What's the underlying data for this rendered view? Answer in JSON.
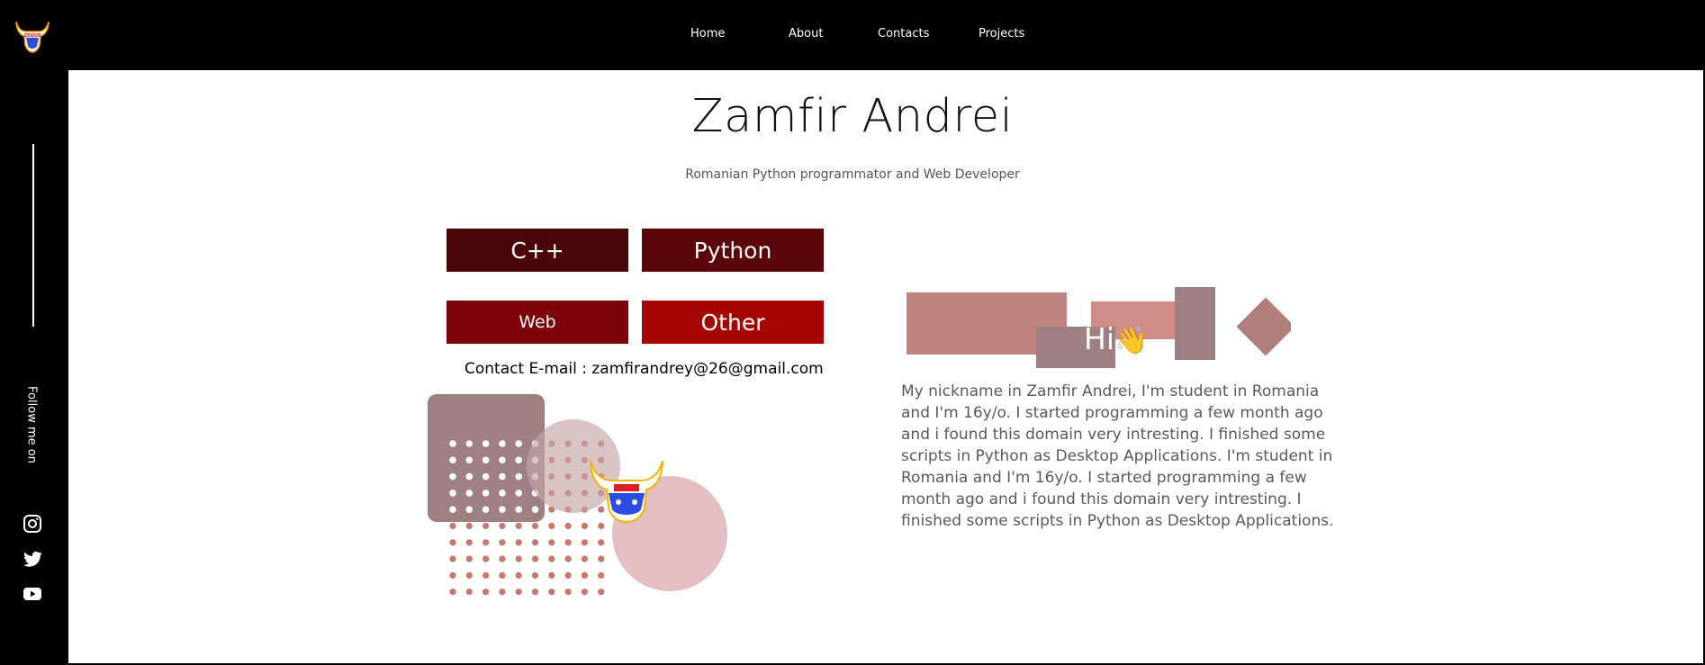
{
  "nav": {
    "items": [
      "Home",
      "About",
      "Contacts",
      "Projects"
    ]
  },
  "sidebar": {
    "follow_label": "Follow me on",
    "social_icons": [
      "instagram-icon",
      "twitter-icon",
      "youtube-icon"
    ]
  },
  "hero": {
    "name": "Zamfir Andrei",
    "tagline": "Romanian Python programmator and Web Developer"
  },
  "skills": [
    "C++",
    "Python",
    "Web",
    "Other"
  ],
  "contact": {
    "text": "Contact E-mail : zamfirandrey@26@gmail.com"
  },
  "about": {
    "greeting": "Hi",
    "greeting_emoji": "👋",
    "text": "My nickname in Zamfir Andrei, I'm student in Romania and I'm 16y/o. I started programming a few month ago and i found this domain very intresting. I finished some scripts in Python as Desktop Applications. I'm student in Romania and I'm 16y/o. I started programming a few month ago and i found this domain very intresting. I finished some scripts in Python as Desktop Applications."
  },
  "colors": {
    "sidebar_bg": "#000000",
    "skill_cpp": "#4a0509",
    "skill_python": "#5b060a",
    "skill_web": "#7d0308",
    "skill_other": "#a60303",
    "shape_rose": "#c0847f",
    "shape_mauve": "#9e7f82",
    "shape_pink": "#e8b7b9"
  }
}
